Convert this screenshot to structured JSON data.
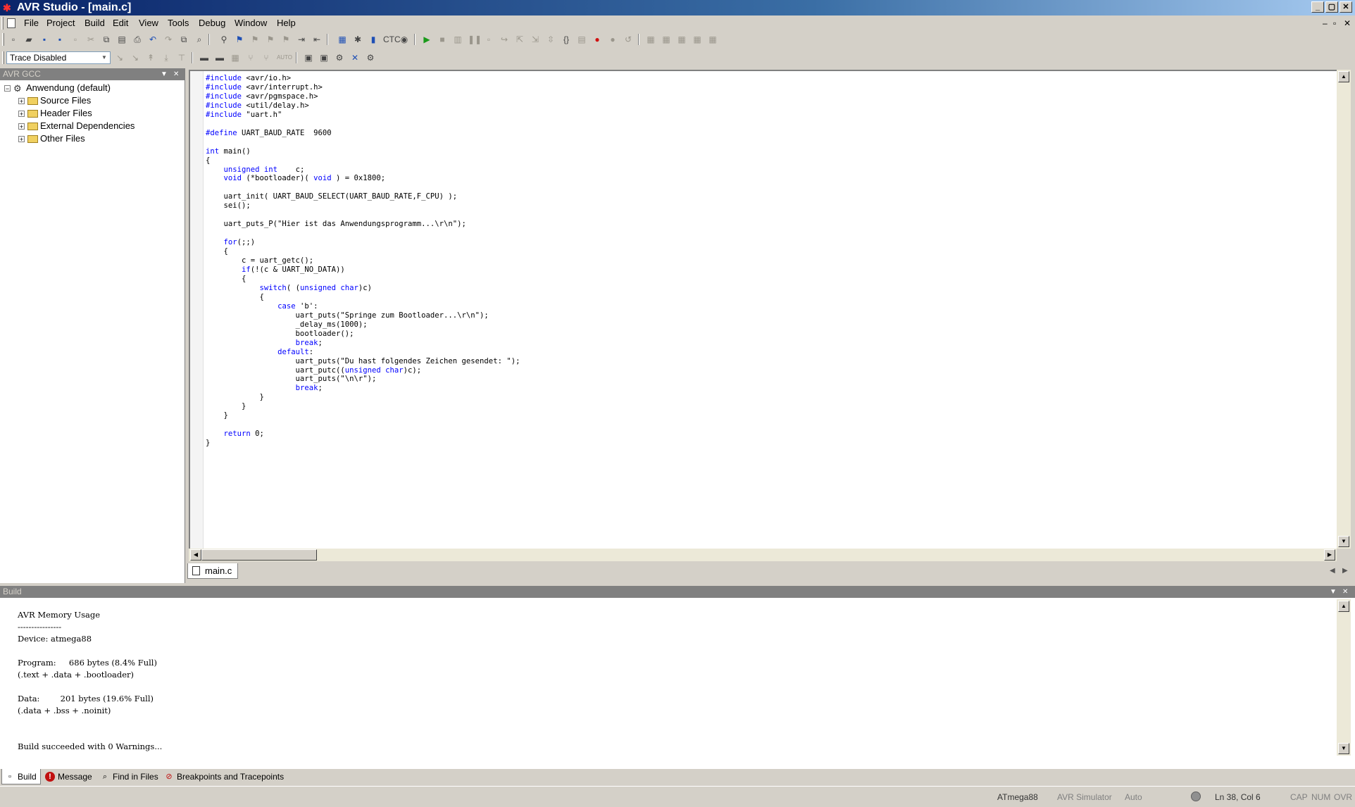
{
  "window": {
    "title": "AVR Studio - [main.c]",
    "controls": {
      "minimize": "_",
      "maximize": "▢",
      "close": "✕"
    }
  },
  "menubar": {
    "items": [
      "File",
      "Project",
      "Build",
      "Edit",
      "View",
      "Tools",
      "Debug",
      "Window",
      "Help"
    ],
    "mdi_controls": {
      "minimize": "–",
      "restore": "▫",
      "close": "✕"
    }
  },
  "toolbar": {
    "trace_mode": "Trace Disabled",
    "icons_row1": [
      "new-file-icon",
      "open-file-icon",
      "save-icon",
      "save-all-icon",
      "close-icon",
      "cut-icon",
      "copy-icon",
      "paste-icon",
      "print-icon",
      "undo-icon",
      "redo-icon",
      "window-icon",
      "find-in-files-icon",
      "find-icon",
      "bookmark-icon",
      "bookmark-next-icon",
      "bookmark-prev-icon",
      "bookmark-clear-icon",
      "indent-icon",
      "outdent-icon",
      "build-icon",
      "compile-icon",
      "build-and-run-icon",
      "rebuild-icon",
      "stk-icon",
      "start-debugging-icon",
      "stop-debugging-icon",
      "reset-icon",
      "break-icon",
      "step-into-icon",
      "step-over-icon",
      "step-out-icon",
      "run-to-cursor-icon",
      "auto-step-icon",
      "quickwatch-icon",
      "toggle-breakpoint-icon",
      "remove-breakpoints-icon",
      "show-next-statement-icon",
      "disassembler-icon",
      "watch-icon",
      "memory-icon",
      "register-icon",
      "io-view-icon"
    ],
    "icons_row2": [
      "trace-start-icon",
      "trace-stop-icon",
      "trace-step-icon",
      "trace-mark-icon",
      "trace-end-icon",
      "trace-auto-icon",
      "con-icon",
      "stk-mode-icon",
      "chip-icon",
      "debug-connect-icon",
      "debug-disconnect-icon",
      "program-icon",
      "program-fuses-icon",
      "auto-program-icon",
      "cancel-icon",
      "settings-icon"
    ],
    "auto_label": "AUTO"
  },
  "project_panel": {
    "title": "AVR GCC",
    "root": "Anwendung (default)",
    "folders": [
      "Source Files",
      "Header Files",
      "External Dependencies",
      "Other Files"
    ]
  },
  "editor": {
    "tab_label": "main.c",
    "cursor": "Ln 38, Col 6",
    "code_lines": [
      [
        {
          "t": "#include",
          "k": 1
        },
        {
          "t": " <avr/io.h>"
        }
      ],
      [
        {
          "t": "#include",
          "k": 1
        },
        {
          "t": " <avr/interrupt.h>"
        }
      ],
      [
        {
          "t": "#include",
          "k": 1
        },
        {
          "t": " <avr/pgmspace.h>"
        }
      ],
      [
        {
          "t": "#include",
          "k": 1
        },
        {
          "t": " <util/delay.h>"
        }
      ],
      [
        {
          "t": "#include",
          "k": 1
        },
        {
          "t": " \"uart.h\""
        }
      ],
      [],
      [
        {
          "t": "#define",
          "k": 1
        },
        {
          "t": " UART_BAUD_RATE  9600"
        }
      ],
      [],
      [
        {
          "t": "int",
          "k": 1
        },
        {
          "t": " main()"
        }
      ],
      [
        {
          "t": "{"
        }
      ],
      [
        {
          "t": "    "
        },
        {
          "t": "unsigned int",
          "k": 1
        },
        {
          "t": "    c;"
        }
      ],
      [
        {
          "t": "    "
        },
        {
          "t": "void",
          "k": 1
        },
        {
          "t": " (*bootloader)( "
        },
        {
          "t": "void",
          "k": 1
        },
        {
          "t": " ) = 0x1800;"
        }
      ],
      [],
      [
        {
          "t": "    uart_init( UART_BAUD_SELECT(UART_BAUD_RATE,F_CPU) );"
        }
      ],
      [
        {
          "t": "    sei();"
        }
      ],
      [],
      [
        {
          "t": "    uart_puts_P(\"Hier ist das Anwendungsprogramm...\\r\\n\");"
        }
      ],
      [],
      [
        {
          "t": "    "
        },
        {
          "t": "for",
          "k": 1
        },
        {
          "t": "(;;)"
        }
      ],
      [
        {
          "t": "    {"
        }
      ],
      [
        {
          "t": "        c = uart_getc();"
        }
      ],
      [
        {
          "t": "        "
        },
        {
          "t": "if",
          "k": 1
        },
        {
          "t": "(!(c & UART_NO_DATA))"
        }
      ],
      [
        {
          "t": "        {"
        }
      ],
      [
        {
          "t": "            "
        },
        {
          "t": "switch",
          "k": 1
        },
        {
          "t": "( ("
        },
        {
          "t": "unsigned char",
          "k": 1
        },
        {
          "t": ")c)"
        }
      ],
      [
        {
          "t": "            {"
        }
      ],
      [
        {
          "t": "                "
        },
        {
          "t": "case",
          "k": 1
        },
        {
          "t": " 'b':"
        }
      ],
      [
        {
          "t": "                    uart_puts(\"Springe zum Bootloader...\\r\\n\");"
        }
      ],
      [
        {
          "t": "                    _delay_ms(1000);"
        }
      ],
      [
        {
          "t": "                    bootloader();"
        }
      ],
      [
        {
          "t": "                    "
        },
        {
          "t": "break",
          "k": 1
        },
        {
          "t": ";"
        }
      ],
      [
        {
          "t": "                "
        },
        {
          "t": "default",
          "k": 1
        },
        {
          "t": ":"
        }
      ],
      [
        {
          "t": "                    uart_puts(\"Du hast folgendes Zeichen gesendet: \");"
        }
      ],
      [
        {
          "t": "                    uart_putc(("
        },
        {
          "t": "unsigned char",
          "k": 1
        },
        {
          "t": ")c);"
        }
      ],
      [
        {
          "t": "                    uart_puts(\"\\n\\r\");"
        }
      ],
      [
        {
          "t": "                    "
        },
        {
          "t": "break",
          "k": 1
        },
        {
          "t": ";"
        }
      ],
      [
        {
          "t": "            }"
        }
      ],
      [
        {
          "t": "        }"
        }
      ],
      [
        {
          "t": "    }"
        }
      ],
      [],
      [
        {
          "t": "    "
        },
        {
          "t": "return",
          "k": 1
        },
        {
          "t": " 0;"
        }
      ],
      [
        {
          "t": "}"
        }
      ]
    ]
  },
  "build_panel": {
    "title": "Build",
    "output_lines": [
      "AVR Memory Usage",
      "----------------",
      "Device: atmega88",
      "",
      "Program:     686 bytes (8.4% Full)",
      "(.text + .data + .bootloader)",
      "",
      "Data:        201 bytes (19.6% Full)",
      "(.data + .bss + .noinit)",
      "",
      "",
      "Build succeeded with 0 Warnings..."
    ],
    "tabs": [
      "Build",
      "Message",
      "Find in Files",
      "Breakpoints and Tracepoints"
    ]
  },
  "statusbar": {
    "device": "ATmega88",
    "platform": "AVR Simulator",
    "mode": "Auto",
    "position": "Ln 38, Col 6",
    "cap": "CAP",
    "num": "NUM",
    "ovr": "OVR"
  }
}
